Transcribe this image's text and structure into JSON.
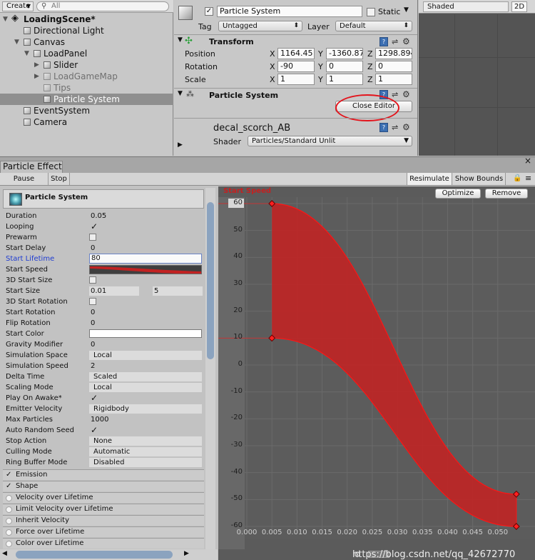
{
  "hierarchy": {
    "create_label": "Create",
    "search_placeholder": "All",
    "items": [
      {
        "label": "LoadingScene*"
      },
      {
        "label": "Directional Light"
      },
      {
        "label": "Canvas"
      },
      {
        "label": "LoadPanel"
      },
      {
        "label": "Slider"
      },
      {
        "label": "LoadGameMap"
      },
      {
        "label": "Tips"
      },
      {
        "label": "Particle System"
      },
      {
        "label": "EventSystem"
      },
      {
        "label": "Camera"
      }
    ]
  },
  "inspector": {
    "object_name": "Particle System",
    "static_label": "Static",
    "tag_label": "Tag",
    "tag_value": "Untagged",
    "layer_label": "Layer",
    "layer_value": "Default",
    "transform": {
      "title": "Transform",
      "position_label": "Position",
      "rotation_label": "Rotation",
      "scale_label": "Scale",
      "axis_x": "X",
      "axis_y": "Y",
      "axis_z": "Z",
      "position": [
        "1164.45",
        "-1360.87",
        "1298.894"
      ],
      "rotation": [
        "-90",
        "0",
        "0"
      ],
      "scale": [
        "1",
        "1",
        "1"
      ]
    },
    "particle_component_title": "Particle System",
    "close_editor_label": "Close Editor",
    "material_name": "decal_scorch_AB",
    "shader_label": "Shader",
    "shader_value": "Particles/Standard Unlit"
  },
  "scene_view": {
    "shading_mode": "Shaded",
    "mode_2d": "2D"
  },
  "particle_effect": {
    "tab_label": "Particle Effect",
    "close_glyph": "×",
    "toolbar": {
      "pause": "Pause",
      "stop": "Stop",
      "resimulate": "Resimulate",
      "show_bounds": "Show Bounds"
    },
    "system_title": "Particle System",
    "properties": [
      {
        "label": "Duration",
        "value": "0.05"
      },
      {
        "label": "Looping",
        "value": "✓"
      },
      {
        "label": "Prewarm",
        "value": ""
      },
      {
        "label": "Start Delay",
        "value": "0"
      },
      {
        "label": "Start Lifetime",
        "value": "80"
      },
      {
        "label": "Start Speed",
        "value": ""
      },
      {
        "label": "3D Start Size",
        "value": ""
      },
      {
        "label": "Start Size",
        "value": "0.01",
        "value2": "5"
      },
      {
        "label": "3D Start Rotation",
        "value": ""
      },
      {
        "label": "Start Rotation",
        "value": "0"
      },
      {
        "label": "Flip Rotation",
        "value": "0"
      },
      {
        "label": "Start Color",
        "value": ""
      },
      {
        "label": "Gravity Modifier",
        "value": "0"
      },
      {
        "label": "Simulation Space",
        "value": "Local"
      },
      {
        "label": "Simulation Speed",
        "value": "2"
      },
      {
        "label": "Delta Time",
        "value": "Scaled"
      },
      {
        "label": "Scaling Mode",
        "value": "Local"
      },
      {
        "label": "Play On Awake*",
        "value": "✓"
      },
      {
        "label": "Emitter Velocity",
        "value": "Rigidbody"
      },
      {
        "label": "Max Particles",
        "value": "1000"
      },
      {
        "label": "Auto Random Seed",
        "value": "✓"
      },
      {
        "label": "Stop Action",
        "value": "None"
      },
      {
        "label": "Culling Mode",
        "value": "Automatic"
      },
      {
        "label": "Ring Buffer Mode",
        "value": "Disabled"
      }
    ],
    "modules": [
      {
        "label": "Emission",
        "checked": true
      },
      {
        "label": "Shape",
        "checked": true
      },
      {
        "label": "Velocity over Lifetime",
        "checked": false
      },
      {
        "label": "Limit Velocity over Lifetime",
        "checked": false
      },
      {
        "label": "Inherit Velocity",
        "checked": false
      },
      {
        "label": "Force over Lifetime",
        "checked": false
      },
      {
        "label": "Color over Lifetime",
        "checked": false
      }
    ],
    "check_glyph": "✓",
    "curve_editor": {
      "optimize_label": "Optimize",
      "remove_label": "Remove",
      "watermark": "https://blog.csdn.net/qq_42672770"
    }
  },
  "chart_data": {
    "type": "area",
    "title": "Start Speed",
    "xlabel": "",
    "ylabel": "",
    "xlim": [
      0,
      0.055
    ],
    "ylim": [
      -60,
      65
    ],
    "x_ticks": [
      "0.000",
      "0.005",
      "0.010",
      "0.015",
      "0.020",
      "0.025",
      "0.030",
      "0.035",
      "0.040",
      "0.045",
      "0.050"
    ],
    "y_ticks": [
      "60",
      "50",
      "40",
      "30",
      "20",
      "10",
      "0",
      "-10",
      "-20",
      "-30",
      "-40",
      "-50",
      "-60"
    ],
    "series": [
      {
        "x": [
          0.005,
          0.0537
        ],
        "values": [
          60,
          -48
        ]
      },
      {
        "x": [
          0.005,
          0.0537
        ],
        "values": [
          10,
          -60
        ]
      }
    ],
    "fill_color": "#c62020",
    "line_color": "#ff1414"
  }
}
